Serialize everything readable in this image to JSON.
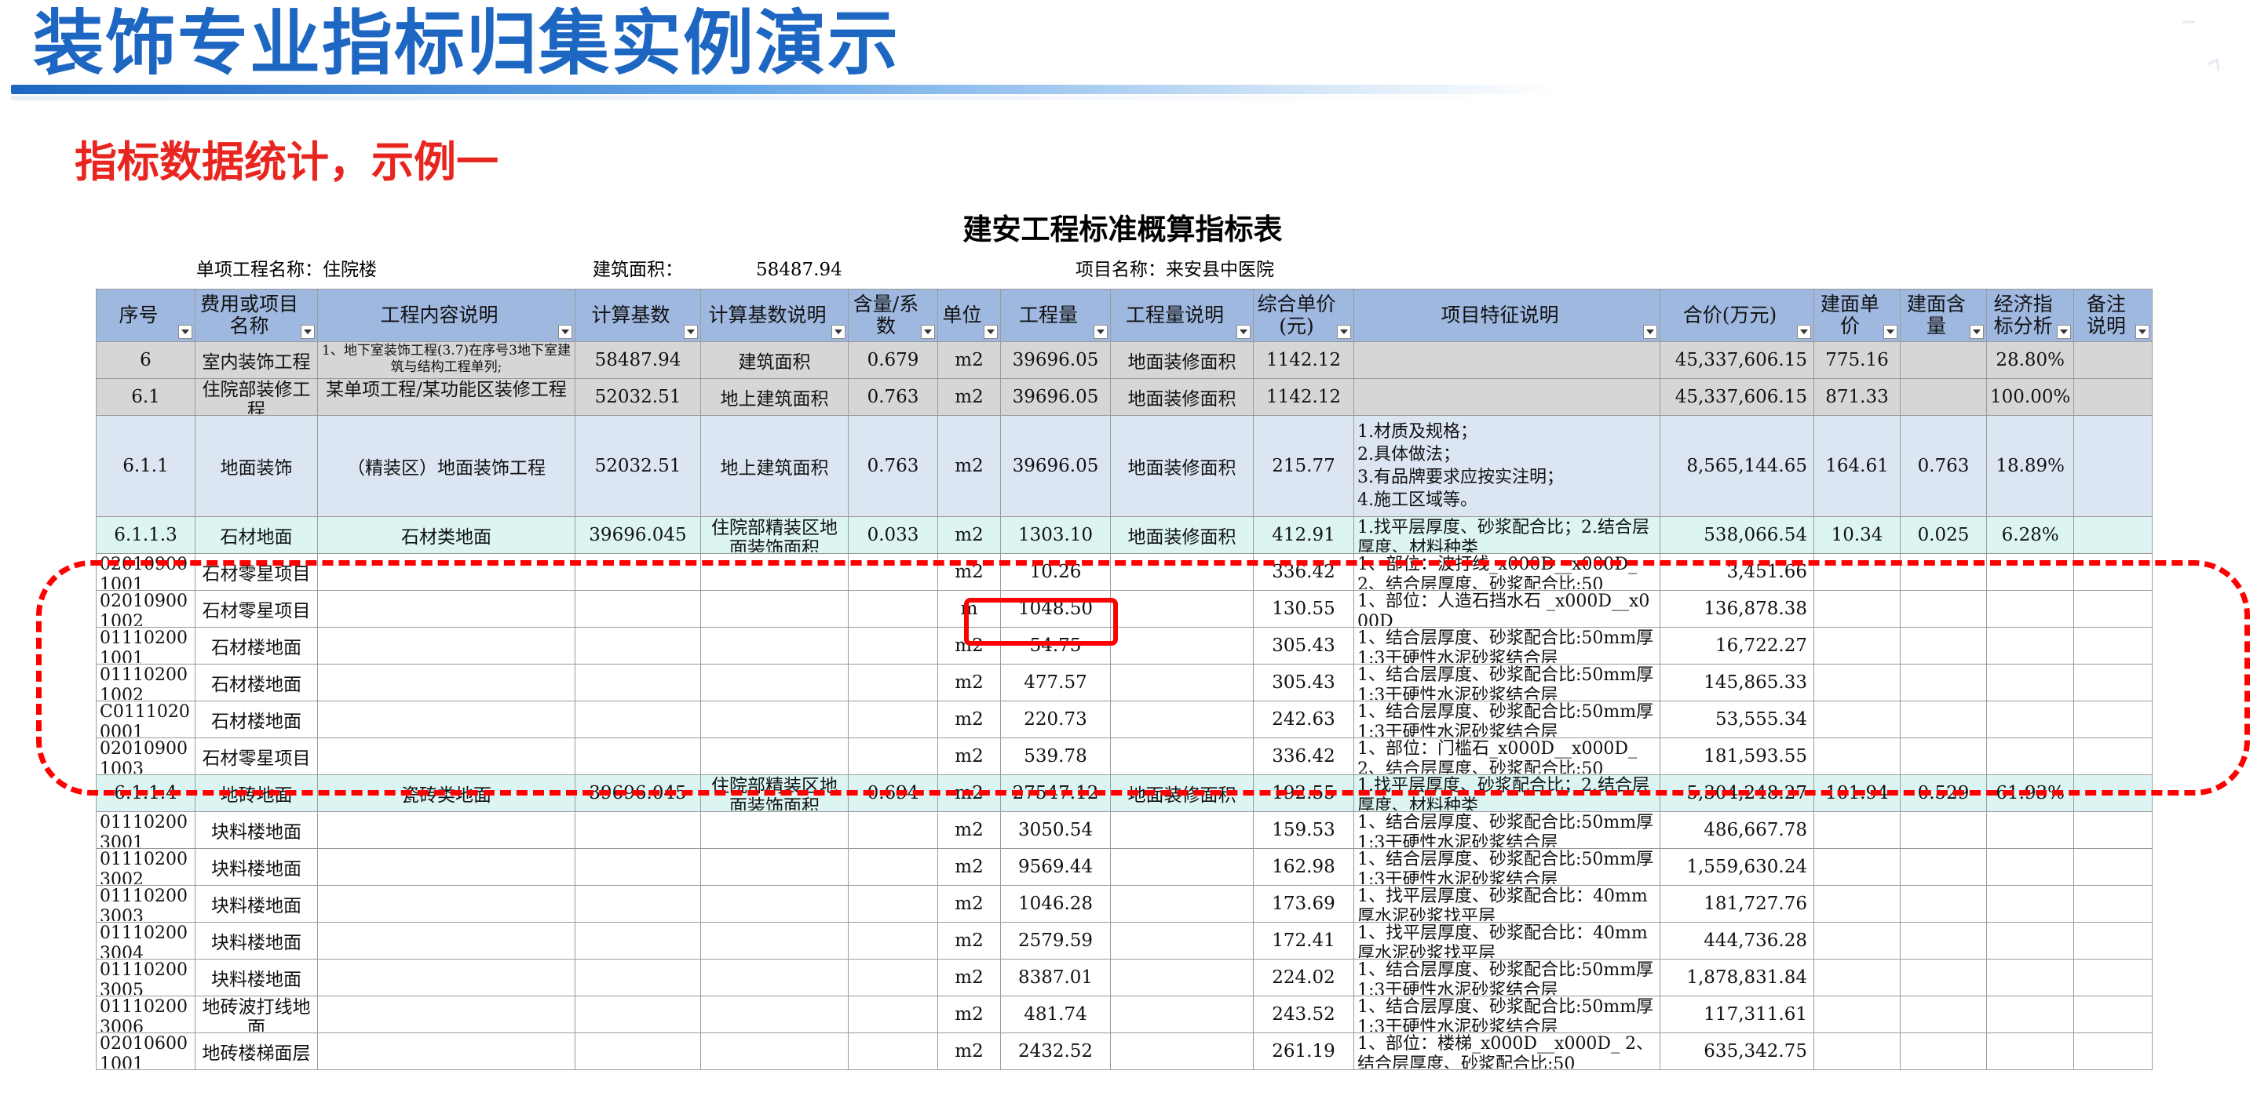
{
  "slide": {
    "title": "装饰专业指标归集实例演示",
    "subtitle": "指标数据统计，示例一"
  },
  "sheet": {
    "title": "建安工程标准概算指标表",
    "info": {
      "project_label": "单项工程名称：住院楼",
      "area_label": "建筑面积：",
      "area_value": "58487.94",
      "item_label": "项目名称：来安县中医院"
    },
    "headers": [
      "序号",
      "费用或项目名称",
      "工程内容说明",
      "计算基数",
      "计算基数说明",
      "含量/系数",
      "单位",
      "工程量",
      "工程量说明",
      "综合单价(元)",
      "项目特征说明",
      "合价(万元)",
      "建面单价",
      "建面含量",
      "经济指标分析",
      "备注说明"
    ],
    "rows": [
      {
        "style": "grey",
        "seq": "6",
        "name": "室内装饰工程",
        "content": "1、地下室装饰工程(3.7)在序号3地下室建筑与结构工程单列;",
        "base": "58487.94",
        "base_desc": "建筑面积",
        "coef": "0.679",
        "unit": "m2",
        "qty": "39696.05",
        "qty_desc": "地面装修面积",
        "price": "1142.12",
        "feature": "",
        "total": "45,337,606.15",
        "area_price": "775.16",
        "area_content": "",
        "ratio": "28.80%",
        "note": ""
      },
      {
        "style": "grey",
        "seq": "6.1",
        "name": "住院部装修工程",
        "content": "某单项工程/某功能区装修工程",
        "base": "52032.51",
        "base_desc": "地上建筑面积",
        "coef": "0.763",
        "unit": "m2",
        "qty": "39696.05",
        "qty_desc": "地面装修面积",
        "price": "1142.12",
        "feature": "",
        "total": "45,337,606.15",
        "area_price": "871.33",
        "area_content": "",
        "ratio": "100.00%",
        "note": ""
      },
      {
        "style": "blue",
        "seq": "6.1.1",
        "name": "地面装饰",
        "content": "（精装区）地面装饰工程",
        "base": "52032.51",
        "base_desc": "地上建筑面积",
        "coef": "0.763",
        "unit": "m2",
        "qty": "39696.05",
        "qty_desc": "地面装修面积",
        "price": "215.77",
        "feature_lines": [
          "1.材质及规格；",
          "2.具体做法；",
          "3.有品牌要求应按实注明；",
          "4.施工区域等。"
        ],
        "total": "8,565,144.65",
        "area_price": "164.61",
        "area_content": "0.763",
        "ratio": "18.89%",
        "note": ""
      },
      {
        "style": "cyan",
        "seq": "6.1.1.3",
        "name": "石材地面",
        "content": "石材类地面",
        "base": "39696.045",
        "base_desc": "住院部精装区地面装饰面积",
        "coef": "0.033",
        "unit": "m2",
        "qty": "1303.10",
        "qty_desc": "地面装修面积",
        "price": "412.91",
        "feature": "1.找平层厚度、砂浆配合比；2.结合层厚度、材料种类",
        "total": "538,066.54",
        "area_price": "10.34",
        "area_content": "0.025",
        "ratio": "6.28%",
        "note": ""
      },
      {
        "style": "plain",
        "seq": "020109001001",
        "name": "石材零星项目",
        "content": "",
        "base": "",
        "base_desc": "",
        "coef": "",
        "unit": "m2",
        "qty": "10.26",
        "qty_desc": "",
        "price": "336.42",
        "feature": "1、部位：波打线_x000D__x000D_ 2、结合层厚度、砂浆配合比:50",
        "total": "3,451.66",
        "area_price": "",
        "area_content": "",
        "ratio": "",
        "note": ""
      },
      {
        "style": "plain",
        "seq": "020109001002",
        "name": "石材零星项目",
        "content": "",
        "base": "",
        "base_desc": "",
        "coef": "",
        "unit": "m",
        "qty": "1048.50",
        "qty_desc": "",
        "price": "130.55",
        "feature": "1、部位：人造石挡水石 _x000D__x000D_",
        "total": "136,878.38",
        "area_price": "",
        "area_content": "",
        "ratio": "",
        "note": ""
      },
      {
        "style": "plain",
        "seq": "011102001001",
        "name": "石材楼地面",
        "content": "",
        "base": "",
        "base_desc": "",
        "coef": "",
        "unit": "m2",
        "qty": "54.75",
        "qty_desc": "",
        "price": "305.43",
        "feature": "1、结合层厚度、砂浆配合比:50mm厚1:3干硬性水泥砂浆结合层",
        "total": "16,722.27",
        "area_price": "",
        "area_content": "",
        "ratio": "",
        "note": ""
      },
      {
        "style": "plain",
        "seq": "011102001002",
        "name": "石材楼地面",
        "content": "",
        "base": "",
        "base_desc": "",
        "coef": "",
        "unit": "m2",
        "qty": "477.57",
        "qty_desc": "",
        "price": "305.43",
        "feature": "1、结合层厚度、砂浆配合比:50mm厚1:3干硬性水泥砂浆结合层",
        "total": "145,865.33",
        "area_price": "",
        "area_content": "",
        "ratio": "",
        "note": ""
      },
      {
        "style": "plain",
        "seq": "C01110200001",
        "name": "石材楼地面",
        "content": "",
        "base": "",
        "base_desc": "",
        "coef": "",
        "unit": "m2",
        "qty": "220.73",
        "qty_desc": "",
        "price": "242.63",
        "feature": "1、结合层厚度、砂浆配合比:50mm厚1:3干硬性水泥砂浆结合层",
        "total": "53,555.34",
        "area_price": "",
        "area_content": "",
        "ratio": "",
        "note": ""
      },
      {
        "style": "plain",
        "seq": "020109001003",
        "name": "石材零星项目",
        "content": "",
        "base": "",
        "base_desc": "",
        "coef": "",
        "unit": "m2",
        "qty": "539.78",
        "qty_desc": "",
        "price": "336.42",
        "feature": "1、部位：门槛石_x000D__x000D_ 2、结合层厚度、砂浆配合比:50",
        "total": "181,593.55",
        "area_price": "",
        "area_content": "",
        "ratio": "",
        "note": ""
      },
      {
        "style": "cyan",
        "seq": "6.1.1.4",
        "name": "地砖地面",
        "content": "瓷砖类地面",
        "base": "39696.045",
        "base_desc": "住院部精装区地面装饰面积",
        "coef": "0.694",
        "unit": "m2",
        "qty": "27547.12",
        "qty_desc": "地面装修面积",
        "price": "192.55",
        "feature": "1.找平层厚度、砂浆配合比；2.结合层厚度、材料种类",
        "total": "5,304,248.27",
        "area_price": "101.94",
        "area_content": "0.529",
        "ratio": "61.93%",
        "note": ""
      },
      {
        "style": "plain",
        "seq": "011102003001",
        "name": "块料楼地面",
        "content": "",
        "base": "",
        "base_desc": "",
        "coef": "",
        "unit": "m2",
        "qty": "3050.54",
        "qty_desc": "",
        "price": "159.53",
        "feature": "1、结合层厚度、砂浆配合比:50mm厚1:3干硬性水泥砂浆结合层",
        "total": "486,667.78",
        "area_price": "",
        "area_content": "",
        "ratio": "",
        "note": ""
      },
      {
        "style": "plain",
        "seq": "011102003002",
        "name": "块料楼地面",
        "content": "",
        "base": "",
        "base_desc": "",
        "coef": "",
        "unit": "m2",
        "qty": "9569.44",
        "qty_desc": "",
        "price": "162.98",
        "feature": "1、结合层厚度、砂浆配合比:50mm厚1:3干硬性水泥砂浆结合层",
        "total": "1,559,630.24",
        "area_price": "",
        "area_content": "",
        "ratio": "",
        "note": ""
      },
      {
        "style": "plain",
        "seq": "011102003003",
        "name": "块料楼地面",
        "content": "",
        "base": "",
        "base_desc": "",
        "coef": "",
        "unit": "m2",
        "qty": "1046.28",
        "qty_desc": "",
        "price": "173.69",
        "feature": "1、找平层厚度、砂浆配合比：40mm厚水泥砂浆找平层",
        "total": "181,727.76",
        "area_price": "",
        "area_content": "",
        "ratio": "",
        "note": ""
      },
      {
        "style": "plain",
        "seq": "011102003004",
        "name": "块料楼地面",
        "content": "",
        "base": "",
        "base_desc": "",
        "coef": "",
        "unit": "m2",
        "qty": "2579.59",
        "qty_desc": "",
        "price": "172.41",
        "feature": "1、找平层厚度、砂浆配合比：40mm厚水泥砂浆找平层",
        "total": "444,736.28",
        "area_price": "",
        "area_content": "",
        "ratio": "",
        "note": ""
      },
      {
        "style": "plain",
        "seq": "011102003005",
        "name": "块料楼地面",
        "content": "",
        "base": "",
        "base_desc": "",
        "coef": "",
        "unit": "m2",
        "qty": "8387.01",
        "qty_desc": "",
        "price": "224.02",
        "feature": "1、结合层厚度、砂浆配合比:50mm厚1:3干硬性水泥砂浆结合层",
        "total": "1,878,831.84",
        "area_price": "",
        "area_content": "",
        "ratio": "",
        "note": ""
      },
      {
        "style": "plain",
        "seq": "011102003006",
        "name": "地砖波打线地面",
        "content": "",
        "base": "",
        "base_desc": "",
        "coef": "",
        "unit": "m2",
        "qty": "481.74",
        "qty_desc": "",
        "price": "243.52",
        "feature": "1、结合层厚度、砂浆配合比:50mm厚1:3干硬性水泥砂浆结合层",
        "total": "117,311.61",
        "area_price": "",
        "area_content": "",
        "ratio": "",
        "note": ""
      },
      {
        "style": "plain",
        "seq": "020106001001",
        "name": "地砖楼梯面层",
        "content": "",
        "base": "",
        "base_desc": "",
        "coef": "",
        "unit": "m2",
        "qty": "2432.52",
        "qty_desc": "",
        "price": "261.19",
        "feature": "1、部位：楼梯_x000D__x000D_ 2、结合层厚度、砂浆配合比:50",
        "total": "635,342.75",
        "area_price": "",
        "area_content": "",
        "ratio": "",
        "note": ""
      }
    ]
  },
  "colors": {
    "title_blue": "#1d66c2",
    "subtitle_red": "#e8251f",
    "header_blue": "#9fb8e0",
    "row_grey": "#d6d6d6",
    "row_blue": "#dce6f3",
    "row_cyan": "#dcf5f3",
    "annotation_red": "#ff0000"
  }
}
